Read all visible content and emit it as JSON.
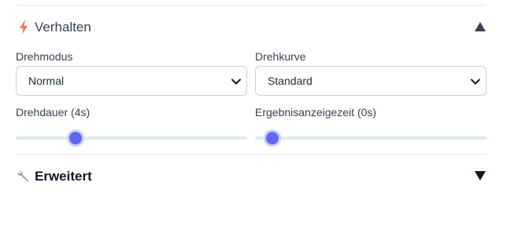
{
  "behavior_section": {
    "title": "Verhalten",
    "icon": "lightning-icon",
    "expanded": true,
    "icon_color": "#f97350"
  },
  "spin_mode": {
    "label": "Drehmodus",
    "value": "Normal"
  },
  "spin_curve": {
    "label": "Drehkurve",
    "value": "Standard"
  },
  "spin_duration": {
    "label": "Drehdauer (4s)",
    "level": 0.24
  },
  "result_display_time": {
    "label": "Ergebnisanzeigezeit (0s)",
    "level": 0.04
  },
  "advanced_section": {
    "title": "Erweitert",
    "icon": "wrench-icon",
    "expanded": false
  },
  "colors": {
    "slider_thumb": "#6366f1",
    "slider_track": "#e2e8f0",
    "divider": "#e5e7eb"
  }
}
